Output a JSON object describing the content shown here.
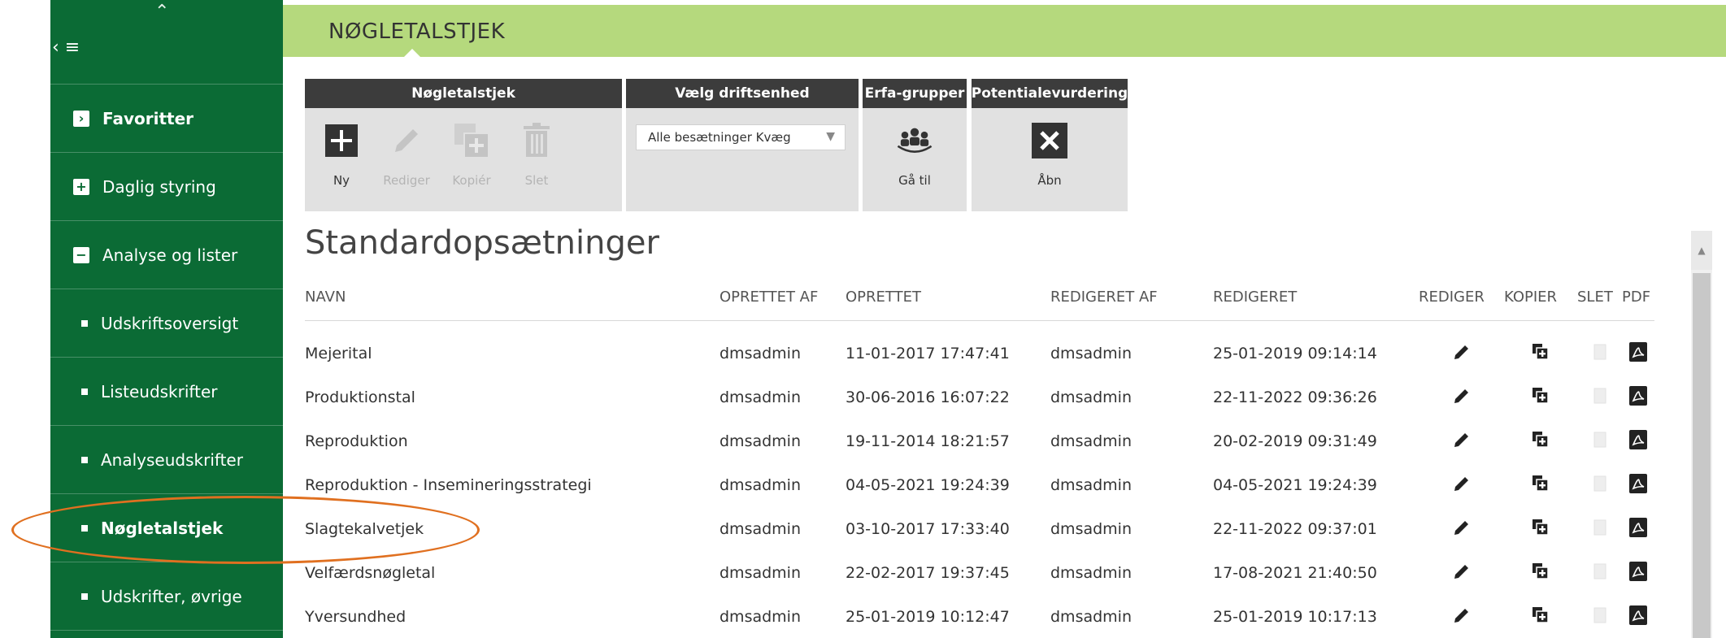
{
  "sidebar": {
    "items": [
      {
        "label": "Favoritter",
        "marker": "›",
        "bold": true
      },
      {
        "label": "Daglig styring",
        "marker": "+"
      },
      {
        "label": "Analyse og lister",
        "marker": "−"
      },
      {
        "label": "Udskriftsoversigt",
        "marker": "bullet"
      },
      {
        "label": "Listeudskrifter",
        "marker": "bullet"
      },
      {
        "label": "Analyseudskrifter",
        "marker": "bullet"
      },
      {
        "label": "Nøgletalstjek",
        "marker": "bullet",
        "bold": true
      },
      {
        "label": "Udskrifter, øvrige",
        "marker": "bullet"
      }
    ]
  },
  "header": {
    "title": "NØGLETALSTJEK"
  },
  "toolbar": {
    "groups": [
      {
        "title": "Nøgletalstjek",
        "tools": [
          {
            "label": "Ny",
            "icon": "plus-icon",
            "enabled": true
          },
          {
            "label": "Rediger",
            "icon": "pencil-icon",
            "enabled": false
          },
          {
            "label": "Kopiér",
            "icon": "copy-icon",
            "enabled": false
          },
          {
            "label": "Slet",
            "icon": "trash-icon",
            "enabled": false
          }
        ]
      },
      {
        "title": "Vælg driftsenhed",
        "select_value": "Alle besætninger Kvæg"
      },
      {
        "title": "Erfa-grupper",
        "tools": [
          {
            "label": "Gå til",
            "icon": "group-icon",
            "enabled": true
          }
        ]
      },
      {
        "title": "Potentialevurdering",
        "tools": [
          {
            "label": "Åbn",
            "icon": "excel-icon",
            "enabled": true
          }
        ]
      }
    ]
  },
  "section": {
    "title": "Standardopsætninger"
  },
  "table": {
    "columns": [
      "NAVN",
      "OPRETTET AF",
      "OPRETTET",
      "REDIGERET AF",
      "REDIGERET",
      "REDIGER",
      "KOPIER",
      "SLET",
      "PDF"
    ],
    "rows": [
      [
        "Mejerital",
        "dmsadmin",
        "11-01-2017 17:47:41",
        "dmsadmin",
        "25-01-2019 09:14:14"
      ],
      [
        "Produktionstal",
        "dmsadmin",
        "30-06-2016 16:07:22",
        "dmsadmin",
        "22-11-2022 09:36:26"
      ],
      [
        "Reproduktion",
        "dmsadmin",
        "19-11-2014 18:21:57",
        "dmsadmin",
        "20-02-2019 09:31:49"
      ],
      [
        "Reproduktion - Insemineringsstrategi",
        "dmsadmin",
        "04-05-2021 19:24:39",
        "dmsadmin",
        "04-05-2021 19:24:39"
      ],
      [
        "Slagtekalvetjek",
        "dmsadmin",
        "03-10-2017 17:33:40",
        "dmsadmin",
        "22-11-2022 09:37:01"
      ],
      [
        "Velfærdsnøgletal",
        "dmsadmin",
        "22-02-2017 19:37:45",
        "dmsadmin",
        "17-08-2021 21:40:50"
      ],
      [
        "Yversundhed",
        "dmsadmin",
        "25-01-2019 10:12:47",
        "dmsadmin",
        "25-01-2019 10:17:13"
      ]
    ]
  },
  "colors": {
    "sidebar_bg": "#0b6b35",
    "header_bg": "#b5d97d",
    "highlight": "#e07020"
  }
}
